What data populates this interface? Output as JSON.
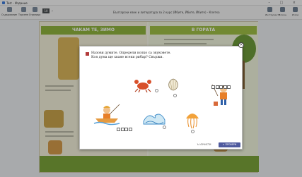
{
  "window": {
    "title": "Test - Издание"
  },
  "toolbar": {
    "items": [
      "Съдържание",
      "Търсене",
      "Страница"
    ],
    "page": "10",
    "doc_title": "Български език и литература за 2 курс (Ѝбите, Ѝбите, Ѝбите) - Клетка",
    "right_items": [
      "Инструменти",
      "Помощ",
      "Изход"
    ]
  },
  "book": {
    "left_header": "ЧАКАМ ТЕ, ЗИМО",
    "right_header": "В ГОРАТА"
  },
  "modal": {
    "instruction_line1": "Назови думите. Определи колко са звуковете.",
    "instruction_line2": "Коя дума ще хване всеки рибар? Свържи.",
    "reset_label": "↻ ИЗЧИСТИ",
    "check_label": "✔ ПРОВЕРИ",
    "close_label": "×"
  }
}
